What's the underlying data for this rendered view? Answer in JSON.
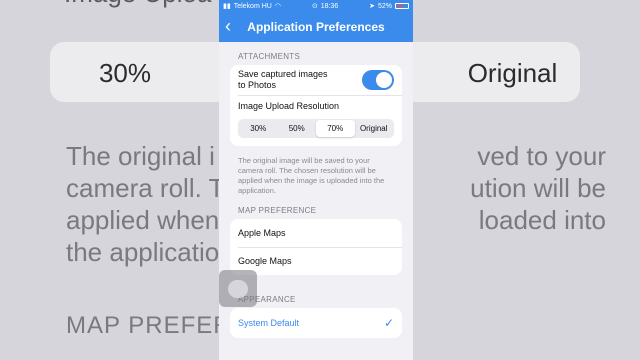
{
  "status": {
    "carrier": "Telekom HU",
    "time": "18:36",
    "battery": "52%"
  },
  "nav": {
    "title": "Application Preferences",
    "back_icon": "chevron-left-icon"
  },
  "attachments": {
    "header": "ATTACHMENTS",
    "save_label_line1": "Save captured images",
    "save_label_line2": "to Photos",
    "save_toggle_on": true,
    "resolution_label": "Image Upload Resolution",
    "resolution_options": [
      "30%",
      "50%",
      "70%",
      "Original"
    ],
    "resolution_selected": "70%",
    "note": "The original image will be saved to your camera roll. The chosen resolution will be applied when the image is uploaded into the application."
  },
  "map": {
    "header": "MAP PREFERENCE",
    "options": [
      "Apple Maps",
      "Google Maps"
    ]
  },
  "appearance": {
    "header": "APPEARANCE",
    "selected": "System Default"
  },
  "background": {
    "title_fragment": "Image Uploa",
    "seg_first": "30%",
    "seg_last": "Original",
    "desc_lines": [
      "The original i",
      "ved to your",
      "camera roll. T",
      "ution will be",
      "applied when",
      "loaded into",
      "the applicatio"
    ],
    "map_fragment": "MAP PREFER"
  },
  "colors": {
    "accent": "#3b8bec"
  }
}
